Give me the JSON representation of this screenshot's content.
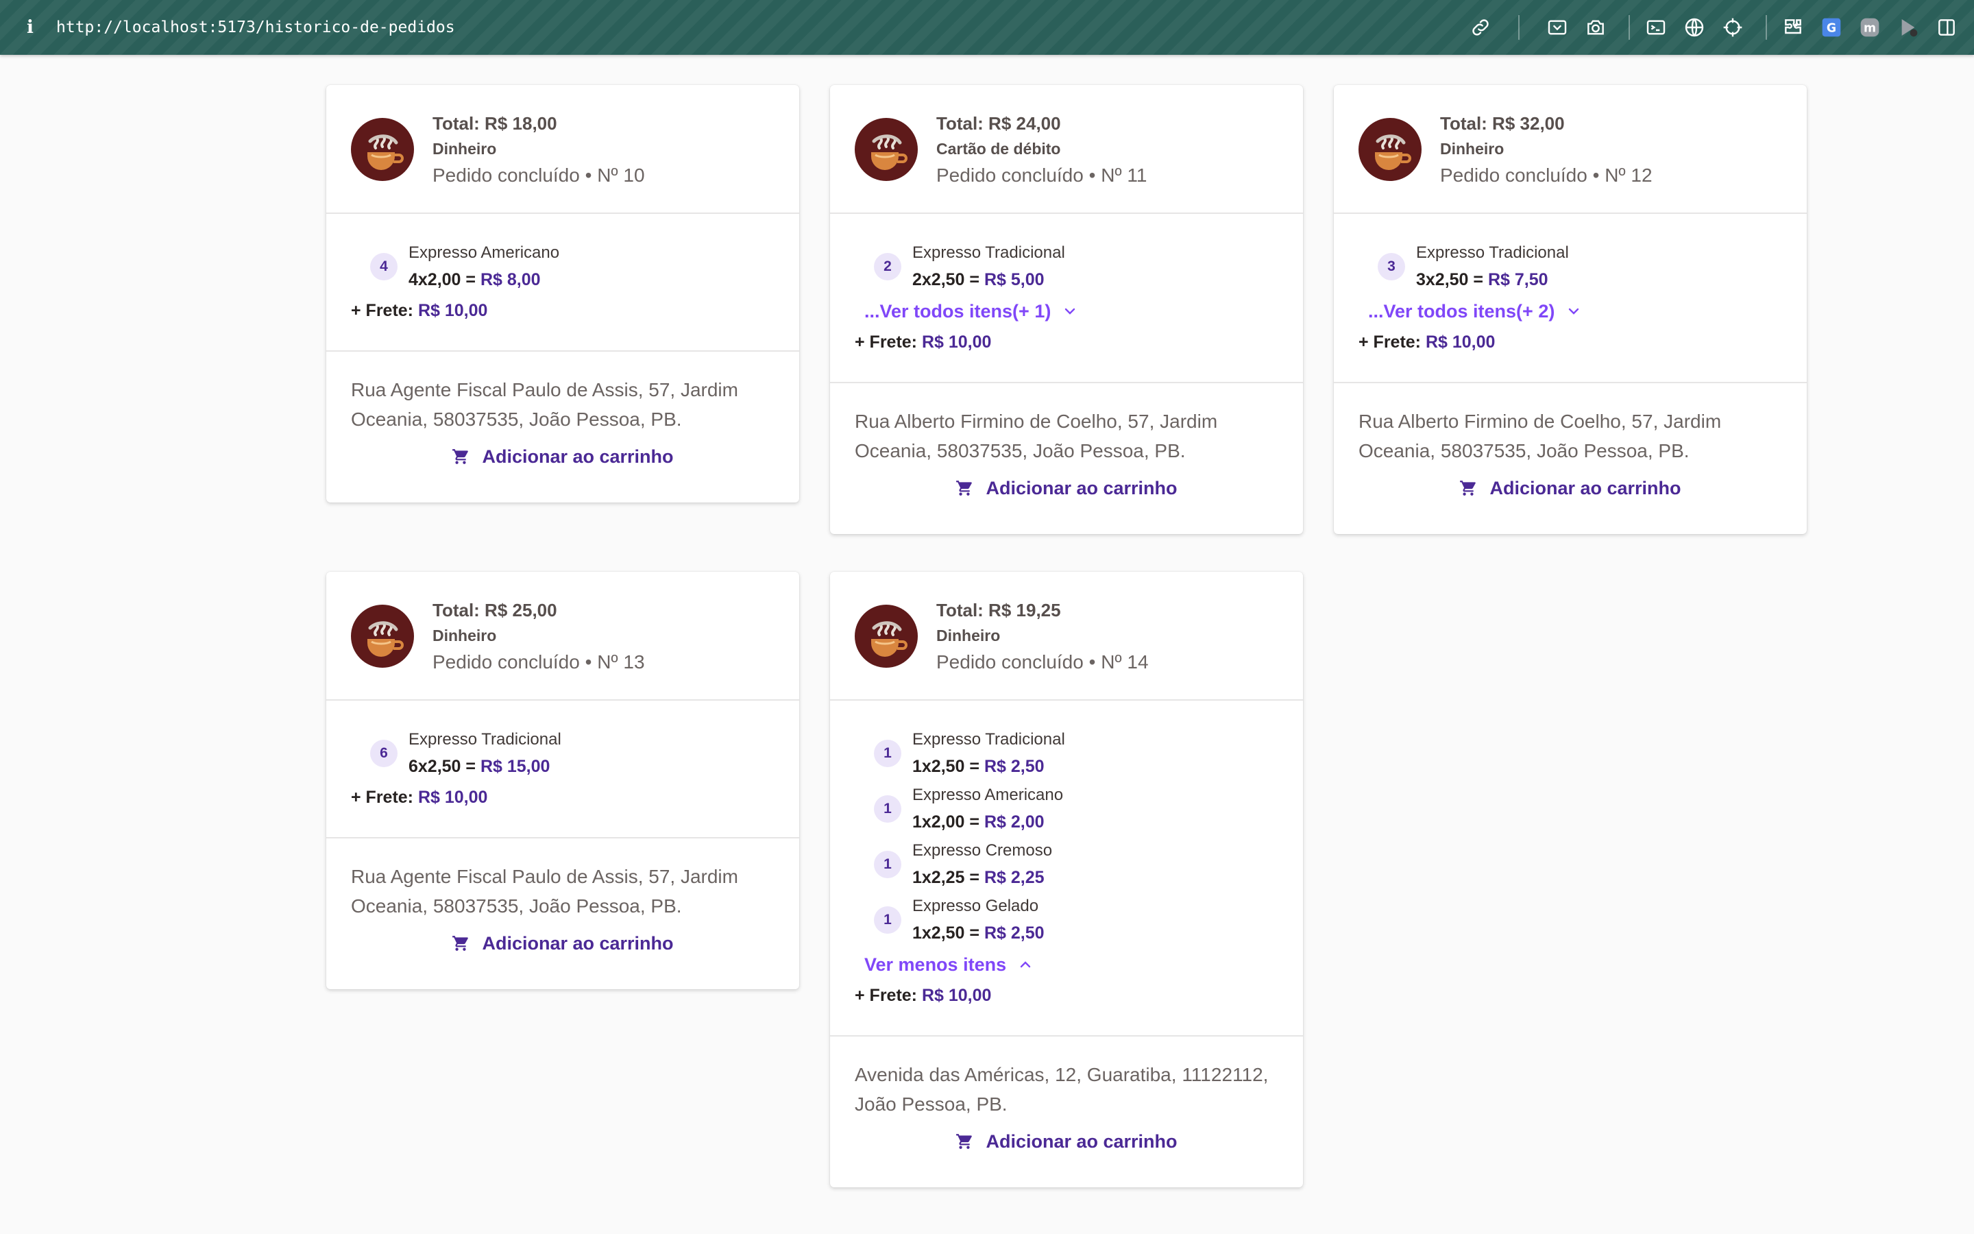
{
  "browser": {
    "url": "http://localhost:5173/historico-de-pedidos",
    "toolbar_icons": [
      "link-icon",
      "screenshot-area-icon",
      "camera-icon",
      "terminal-icon",
      "globe-icon",
      "crosshair-icon",
      "extensions-icon",
      "translate-icon",
      "m-extension-icon",
      "media-extension-icon",
      "sidebar-icon"
    ]
  },
  "colors": {
    "accent": "#8047f8",
    "accent_dark": "#4b2995",
    "badge_bg": "#ebe5f9",
    "browser_bar": "#2b5f59",
    "logo_bg": "#5e1a1a"
  },
  "orders": [
    {
      "total": "Total: R$ 18,00",
      "payment": "Dinheiro",
      "status": "Pedido concluído • Nº 10",
      "items": [
        {
          "qty": "4",
          "name": "Expresso Americano",
          "calc": "4x2,00 = ",
          "price": "R$ 8,00"
        }
      ],
      "toggle": "",
      "frete_label": "+ Frete: ",
      "frete": "R$ 10,00",
      "address": "Rua Agente Fiscal Paulo de Assis, 57, Jardim Oceania, 58037535, João Pessoa, PB.",
      "add_to_cart": "Adicionar ao carrinho"
    },
    {
      "total": "Total: R$ 24,00",
      "payment": "Cartão de débito",
      "status": "Pedido concluído • Nº 11",
      "items": [
        {
          "qty": "2",
          "name": "Expresso Tradicional",
          "calc": "2x2,50 = ",
          "price": "R$ 5,00"
        }
      ],
      "toggle": "...Ver todos itens(+ 1)",
      "frete_label": "+ Frete: ",
      "frete": "R$ 10,00",
      "address": "Rua Alberto Firmino de Coelho, 57, Jardim Oceania, 58037535, João Pessoa, PB.",
      "add_to_cart": "Adicionar ao carrinho"
    },
    {
      "total": "Total: R$ 32,00",
      "payment": "Dinheiro",
      "status": "Pedido concluído • Nº 12",
      "items": [
        {
          "qty": "3",
          "name": "Expresso Tradicional",
          "calc": "3x2,50 = ",
          "price": "R$ 7,50"
        }
      ],
      "toggle": "...Ver todos itens(+ 2)",
      "frete_label": "+ Frete: ",
      "frete": "R$ 10,00",
      "address": "Rua Alberto Firmino de Coelho, 57, Jardim Oceania, 58037535, João Pessoa, PB.",
      "add_to_cart": "Adicionar ao carrinho"
    },
    {
      "total": "Total: R$ 25,00",
      "payment": "Dinheiro",
      "status": "Pedido concluído • Nº 13",
      "items": [
        {
          "qty": "6",
          "name": "Expresso Tradicional",
          "calc": "6x2,50 = ",
          "price": "R$ 15,00"
        }
      ],
      "toggle": "",
      "frete_label": "+ Frete: ",
      "frete": "R$ 10,00",
      "address": "Rua Agente Fiscal Paulo de Assis, 57, Jardim Oceania, 58037535, João Pessoa, PB.",
      "add_to_cart": "Adicionar ao carrinho"
    },
    {
      "total": "Total: R$ 19,25",
      "payment": "Dinheiro",
      "status": "Pedido concluído • Nº 14",
      "items": [
        {
          "qty": "1",
          "name": "Expresso Tradicional",
          "calc": "1x2,50 = ",
          "price": "R$ 2,50"
        },
        {
          "qty": "1",
          "name": "Expresso Americano",
          "calc": "1x2,00 = ",
          "price": "R$ 2,00"
        },
        {
          "qty": "1",
          "name": "Expresso Cremoso",
          "calc": "1x2,25 = ",
          "price": "R$ 2,25"
        },
        {
          "qty": "1",
          "name": "Expresso Gelado",
          "calc": "1x2,50 = ",
          "price": "R$ 2,50"
        }
      ],
      "toggle": "Ver menos itens",
      "frete_label": "+ Frete: ",
      "frete": "R$ 10,00",
      "address": "Avenida das Américas, 12, Guaratiba, 11122112, João Pessoa, PB.",
      "add_to_cart": "Adicionar ao carrinho"
    }
  ]
}
